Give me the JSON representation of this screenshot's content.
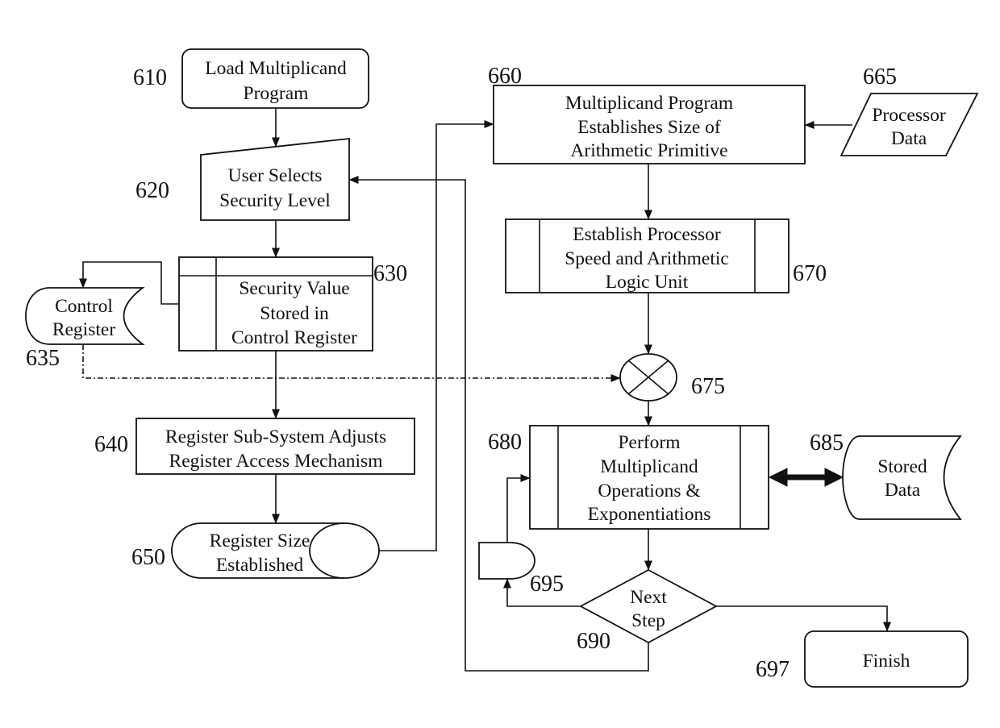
{
  "colors": {
    "stroke": "#111111",
    "background": "#ffffff"
  },
  "nodes": {
    "n610": {
      "ref": "610",
      "shape": "terminal",
      "lines": [
        "Load Multiplicand",
        "Program"
      ]
    },
    "n620": {
      "ref": "620",
      "shape": "manual-input",
      "lines": [
        "User Selects",
        "Security Level"
      ]
    },
    "n630": {
      "ref": "630",
      "shape": "internal-storage",
      "lines": [
        "Security Value",
        "Stored in",
        "Control Register"
      ]
    },
    "n635": {
      "ref": "635",
      "shape": "stored-data",
      "lines": [
        "Control",
        "Register"
      ]
    },
    "n640": {
      "ref": "640",
      "shape": "process",
      "lines": [
        "Register Sub-System Adjusts",
        "Register Access Mechanism"
      ]
    },
    "n650": {
      "ref": "650",
      "shape": "display",
      "lines": [
        "Register Size",
        "Established"
      ]
    },
    "n660": {
      "ref": "660",
      "shape": "process",
      "lines": [
        "Multiplicand Program",
        "Establishes Size of",
        "Arithmetic Primitive"
      ]
    },
    "n665": {
      "ref": "665",
      "shape": "data",
      "lines": [
        "Processor",
        "Data"
      ]
    },
    "n670": {
      "ref": "670",
      "shape": "predefined-process",
      "lines": [
        "Establish Processor",
        "Speed and Arithmetic",
        "Logic Unit"
      ]
    },
    "n675": {
      "ref": "675",
      "shape": "summing-junction",
      "lines": []
    },
    "n680": {
      "ref": "680",
      "shape": "predefined-process",
      "lines": [
        "Perform",
        "Multiplicand",
        "Operations &",
        "Exponentiations"
      ]
    },
    "n685": {
      "ref": "685",
      "shape": "stored-data",
      "lines": [
        "Stored",
        "Data"
      ]
    },
    "n690": {
      "ref": "690",
      "shape": "decision",
      "lines": [
        "Next",
        "Step"
      ]
    },
    "n695": {
      "ref": "695",
      "shape": "delay",
      "lines": []
    },
    "n697": {
      "ref": "697",
      "shape": "terminal",
      "lines": [
        "Finish"
      ]
    }
  },
  "edges": [
    {
      "from": "610",
      "to": "620",
      "style": "solid"
    },
    {
      "from": "620",
      "to": "630",
      "style": "solid"
    },
    {
      "from": "630",
      "to": "635",
      "style": "solid"
    },
    {
      "from": "630",
      "to": "640",
      "style": "solid"
    },
    {
      "from": "640",
      "to": "650",
      "style": "solid"
    },
    {
      "from": "650",
      "to": "660",
      "style": "solid"
    },
    {
      "from": "665",
      "to": "660",
      "style": "solid"
    },
    {
      "from": "660",
      "to": "670",
      "style": "solid"
    },
    {
      "from": "670",
      "to": "675",
      "style": "solid"
    },
    {
      "from": "635",
      "to": "675",
      "style": "dash-dot"
    },
    {
      "from": "675",
      "to": "680",
      "style": "solid"
    },
    {
      "from": "680",
      "to": "685",
      "style": "bidirectional-thick"
    },
    {
      "from": "680",
      "to": "690",
      "style": "solid"
    },
    {
      "from": "690",
      "to": "695",
      "style": "solid"
    },
    {
      "from": "695",
      "to": "680",
      "style": "solid"
    },
    {
      "from": "690",
      "to": "697",
      "style": "solid"
    },
    {
      "from": "690",
      "to": "620",
      "style": "solid"
    }
  ]
}
